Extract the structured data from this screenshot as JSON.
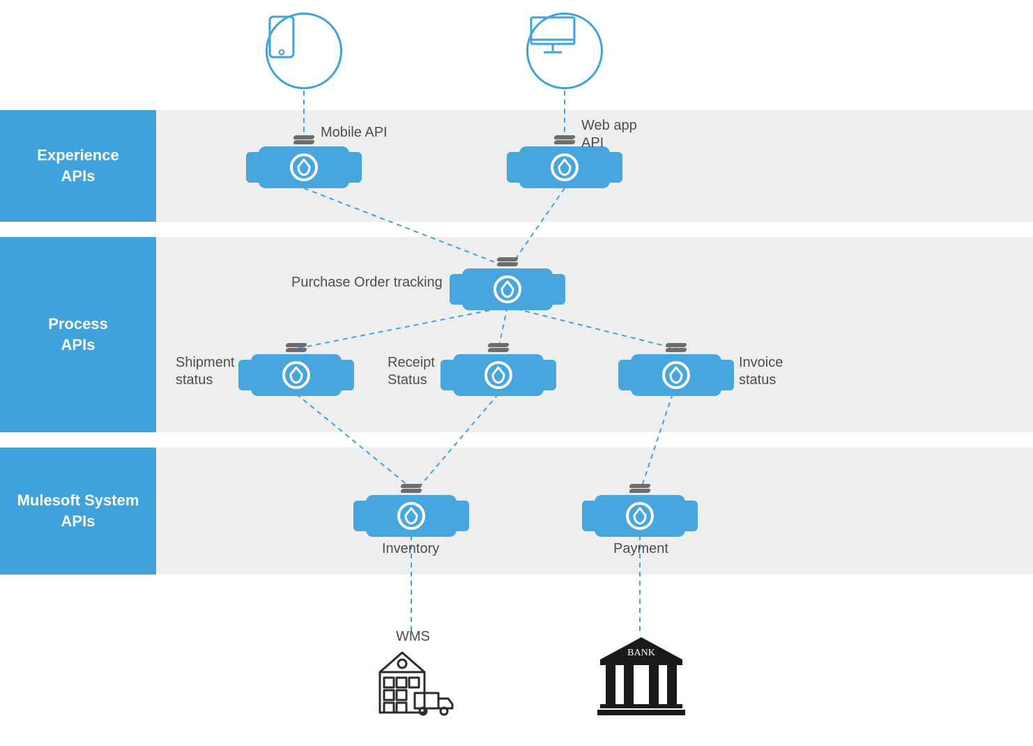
{
  "layers": {
    "experience": "Experience\nAPIs",
    "process": "Process\nAPIs",
    "system": "Mulesoft System\nAPIs"
  },
  "clients": {
    "mobile_icon": "mobile-icon",
    "desktop_icon": "desktop-icon"
  },
  "experience_apis": {
    "mobile": "Mobile API",
    "webapp": "Web app\nAPI"
  },
  "process_apis": {
    "po_tracking": "Purchase Order tracking",
    "shipment": "Shipment\nstatus",
    "receipt": "Receipt\nStatus",
    "invoice": "Invoice\nstatus"
  },
  "system_apis": {
    "inventory": "Inventory",
    "payment": "Payment"
  },
  "backends": {
    "wms": "WMS",
    "bank": "BANK"
  },
  "colors": {
    "accent": "#3fa2dd",
    "band": "#eeeeee",
    "text": "#4d4d4d"
  }
}
